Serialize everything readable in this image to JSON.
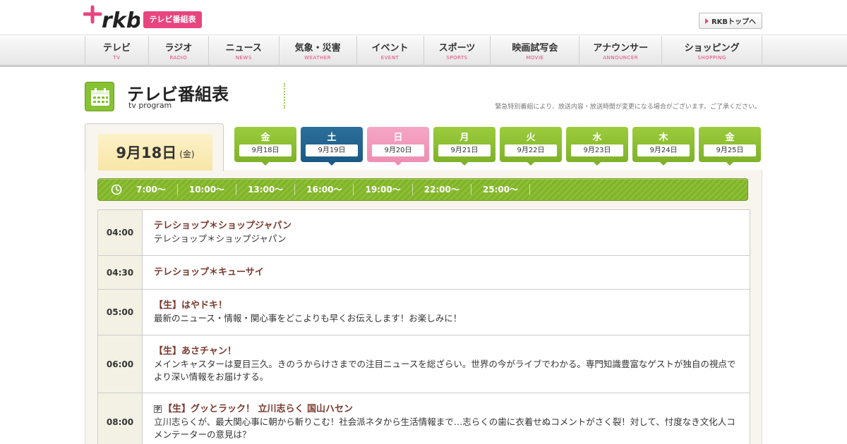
{
  "header": {
    "logo": "+rkb",
    "badge": "テレビ番組表",
    "top_button": "RKBトップへ"
  },
  "nav": [
    {
      "jp": "テレビ",
      "en": "TV"
    },
    {
      "jp": "ラジオ",
      "en": "RADIO"
    },
    {
      "jp": "ニュース",
      "en": "NEWS"
    },
    {
      "jp": "気象・災害",
      "en": "WEATHER"
    },
    {
      "jp": "イベント",
      "en": "EVENT"
    },
    {
      "jp": "スポーツ",
      "en": "SPORTS"
    },
    {
      "jp": "映画試写会",
      "en": "MOVIE"
    },
    {
      "jp": "アナウンサー",
      "en": "ANNOUNCER"
    },
    {
      "jp": "ショッピング",
      "en": "SHOPPING"
    }
  ],
  "page": {
    "title": "テレビ番組表",
    "subtitle": "tv program",
    "notice": "緊急特別番組により、放送内容・放送時間が変更になる場合がございます。ご了承ください。"
  },
  "current": {
    "date": "9月18日",
    "weekday": "(金)"
  },
  "days": [
    {
      "wd": "金",
      "date": "9月18日",
      "kind": "normal"
    },
    {
      "wd": "土",
      "date": "9月19日",
      "kind": "sat"
    },
    {
      "wd": "日",
      "date": "9月20日",
      "kind": "sun"
    },
    {
      "wd": "月",
      "date": "9月21日",
      "kind": "normal"
    },
    {
      "wd": "火",
      "date": "9月22日",
      "kind": "normal"
    },
    {
      "wd": "水",
      "date": "9月23日",
      "kind": "normal"
    },
    {
      "wd": "木",
      "date": "9月24日",
      "kind": "normal"
    },
    {
      "wd": "金",
      "date": "9月25日",
      "kind": "normal"
    }
  ],
  "times": [
    "7:00～",
    "10:00～",
    "13:00～",
    "16:00～",
    "19:00～",
    "22:00～",
    "25:00～"
  ],
  "programs": [
    {
      "time": "04:00",
      "title": "テレショップ＊ショップジャパン",
      "desc": "テレショップ＊ショップジャパン",
      "ji": false
    },
    {
      "time": "04:30",
      "title": "テレショップ＊キューサイ",
      "desc": "",
      "ji": false
    },
    {
      "time": "05:00",
      "title": "【生】はやドキ！",
      "desc": "最新のニュース・情報・関心事をどこよりも早くお伝えします！お楽しみに！",
      "ji": false
    },
    {
      "time": "06:00",
      "title": "【生】あさチャン！",
      "desc": "メインキャスターは夏目三久。きのうからけさまでの注目ニュースを総ざらい。世界の今がライブでわかる。専門知識豊富なゲストが独自の視点でより深い情報をお届けする。",
      "ji": false
    },
    {
      "time": "08:00",
      "title": "【生】グッとラック！ 立川志らく 国山ハセン",
      "desc": "立川志らくが、最大関心事に朝から斬りこむ！社会派ネタから生活情報まで…志らくの歯に衣着せぬコメントがさく裂！対して、忖度なき文化人コメンテーターの意見は？",
      "ji": true,
      "ji_label": "字"
    }
  ],
  "colors": {
    "accent_pink": "#e8457f",
    "green": "#86c232",
    "saturday": "#1a5a85",
    "sunday": "#ee8fb3",
    "program_title": "#7a3b2e"
  }
}
